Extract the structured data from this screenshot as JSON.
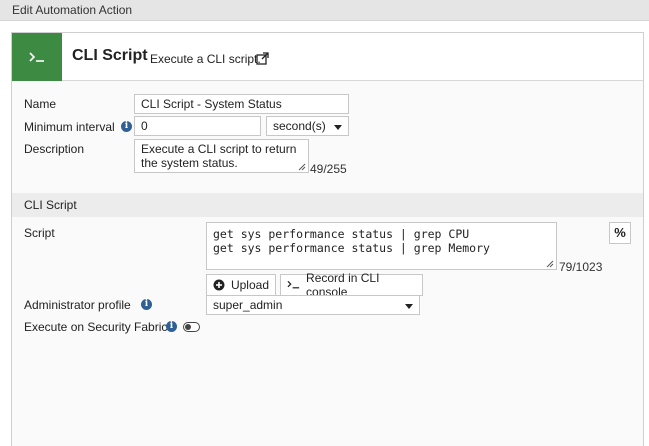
{
  "window": {
    "title": "Edit Automation Action"
  },
  "header": {
    "title": "CLI Script",
    "description": "Execute a CLI script.",
    "accent_color": "#3d8b42"
  },
  "form": {
    "name": {
      "label": "Name",
      "value": "CLI Script - System Status"
    },
    "min_interval": {
      "label": "Minimum interval",
      "value": "0",
      "unit": "second(s)"
    },
    "description": {
      "label": "Description",
      "value": "Execute a CLI script to return the system status.",
      "counter": "49/255"
    }
  },
  "cli_section": {
    "title": "CLI Script",
    "script": {
      "label": "Script",
      "line1": "get sys performance status | grep CPU",
      "line2": "get sys performance status | grep Memory",
      "counter": "79/1023"
    },
    "percent_button": "%",
    "upload_button": "Upload",
    "record_button": "Record in CLI console",
    "admin_profile": {
      "label": "Administrator profile",
      "value": "super_admin"
    },
    "security_fabric": {
      "label": "Execute on Security Fabric",
      "enabled": false
    }
  },
  "icons": {
    "header": "terminal-icon",
    "external_link": "external-link-icon",
    "info": "info-icon",
    "upload": "upload-icon",
    "record": "terminal-icon"
  }
}
